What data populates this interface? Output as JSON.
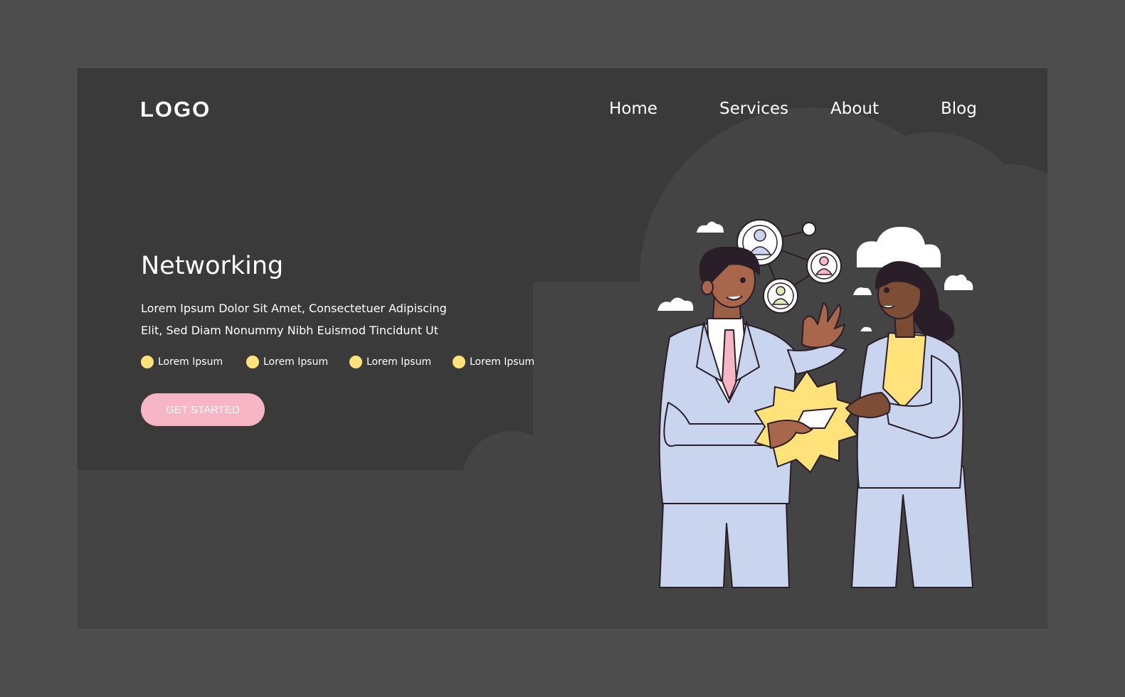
{
  "brand": {
    "logo": "LOGO"
  },
  "nav": {
    "items": [
      "Home",
      "Services",
      "About",
      "Blog"
    ]
  },
  "hero": {
    "title": "Networking",
    "description_line1": "Lorem Ipsum Dolor Sit Amet, Consectetuer Adipiscing",
    "description_line2": "Elit, Sed Diam Nonummy Nibh Euismod Tincidunt Ut",
    "features": [
      "Lorem Ipsum",
      "Lorem Ipsum",
      "Lorem Ipsum",
      "Lorem Ipsum"
    ],
    "cta_label": "GET STARTED"
  },
  "colors": {
    "page_bg": "#4d4d4d",
    "card_bg": "#3a3a3a",
    "cloud_bg": "#444444",
    "accent_yellow": "#ffe27a",
    "accent_pink": "#f6b6c5",
    "suit": "#c9d4ef"
  },
  "icons": [
    "user-network-icon",
    "cloud-icon",
    "badge-icon",
    "business-card-icon"
  ]
}
